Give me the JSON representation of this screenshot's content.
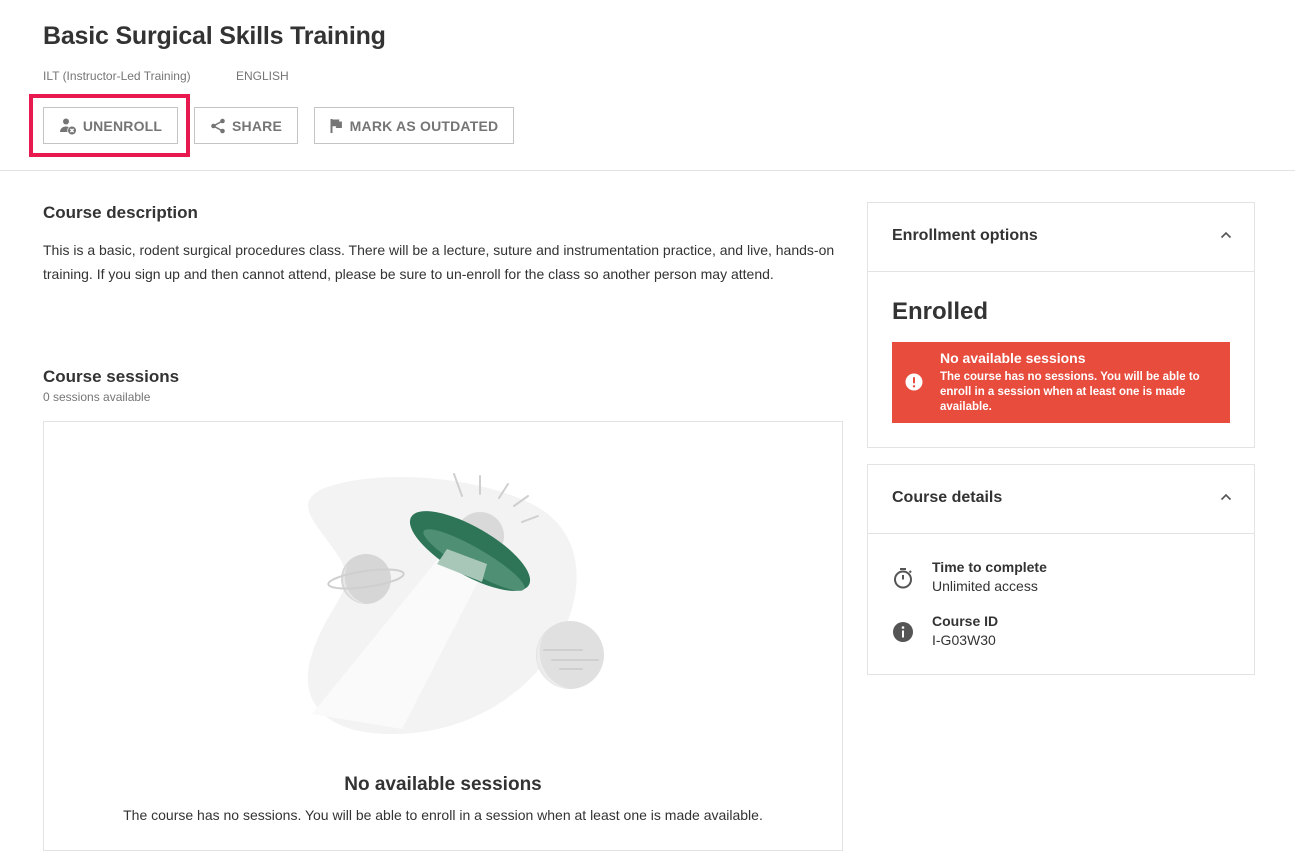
{
  "course": {
    "title": "Basic Surgical Skills Training",
    "type": "ILT (Instructor-Led Training)",
    "language": "ENGLISH"
  },
  "actions": {
    "unenroll": "UNENROLL",
    "share": "SHARE",
    "mark_outdated": "MARK AS OUTDATED"
  },
  "description": {
    "heading": "Course description",
    "text": "This is a basic, rodent surgical procedures class. There will be a lecture, suture and instrumentation practice, and live, hands-on training. If you sign up and then cannot attend, please be sure to un-enroll for the class so another person may attend."
  },
  "sessions": {
    "heading": "Course sessions",
    "count_label": "0 sessions available",
    "empty_title": "No available sessions",
    "empty_text": "The course has no sessions. You will be able to enroll in a session when at least one is made available."
  },
  "enrollment": {
    "heading": "Enrollment options",
    "status": "Enrolled",
    "alert_title": "No available sessions",
    "alert_text": "The course has no sessions. You will be able to enroll in a session when at least one is made available."
  },
  "details": {
    "heading": "Course details",
    "items": [
      {
        "label": "Time to complete",
        "value": "Unlimited access",
        "icon": "stopwatch-icon"
      },
      {
        "label": "Course ID",
        "value": "I-G03W30",
        "icon": "info-icon"
      }
    ]
  },
  "colors": {
    "highlight": "#e8194f",
    "alert": "#e84c3d",
    "ufo": "#2e7558"
  }
}
